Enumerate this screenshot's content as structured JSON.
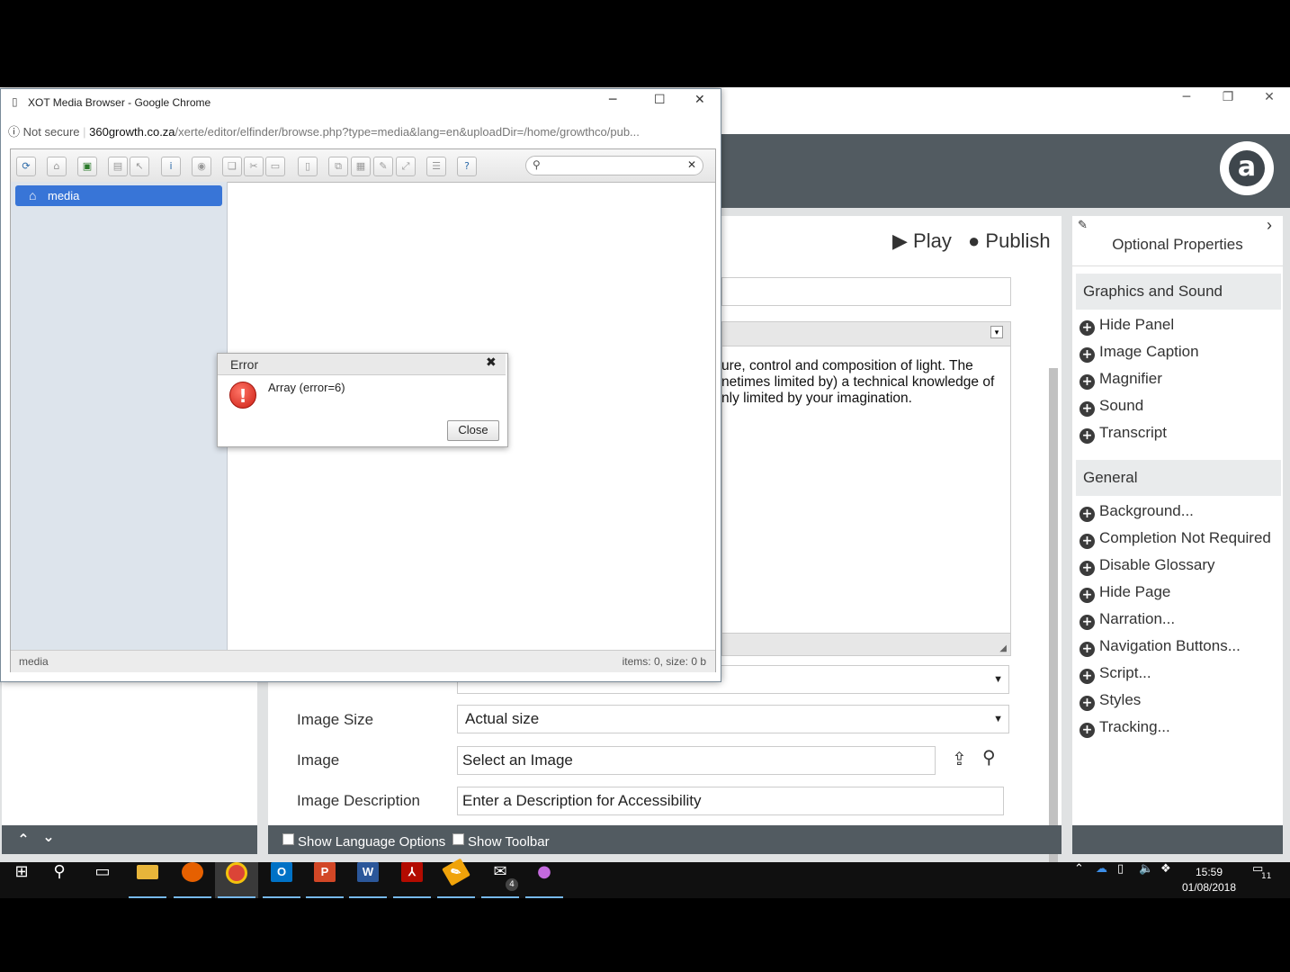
{
  "popup": {
    "window_title": "XOT Media Browser - Google Chrome",
    "security_label": "Not secure",
    "url_domain": "360growth.co.za",
    "url_path": "/xerte/editor/elfinder/browse.php?type=media&lang=en&uploadDir=/home/growthco/pub...",
    "tree_root": "media",
    "status_path": "media",
    "status_info": "items: 0, size: 0 b",
    "search_value": ""
  },
  "error_dialog": {
    "title": "Error",
    "message": "Array (error=6)",
    "close_label": "Close"
  },
  "editor": {
    "play_label": "Play",
    "publish_label": "Publish",
    "text_lines": [
      "ure, control and composition of light. The",
      "netimes limited by) a technical knowledge of",
      "nly limited by your imagination."
    ],
    "image_size_label": "Image Size",
    "image_size_value": "Actual size",
    "image_label": "Image",
    "image_placeholder": "Select an Image",
    "image_description_label": "Image Description",
    "image_description_placeholder": "Enter a Description for Accessibility",
    "show_language_options": "Show Language Options",
    "show_toolbar": "Show Toolbar"
  },
  "optional_properties": {
    "title": "Optional Properties",
    "sections": [
      {
        "title": "Graphics and Sound",
        "items": [
          "Hide Panel",
          "Image Caption",
          "Magnifier",
          "Sound",
          "Transcript"
        ]
      },
      {
        "title": "General",
        "items": [
          "Background...",
          "Completion Not Required",
          "Disable Glossary",
          "Hide Page",
          "Narration...",
          "Navigation Buttons...",
          "Script...",
          "Styles",
          "Tracking..."
        ]
      }
    ]
  },
  "taskbar": {
    "time": "15:59",
    "date": "01/08/2018",
    "mail_badge": "4",
    "notification_badge": "11"
  },
  "colors": {
    "header": "#525b61",
    "tree_selection": "#3875d7",
    "error_icon": "#cc1f14"
  }
}
